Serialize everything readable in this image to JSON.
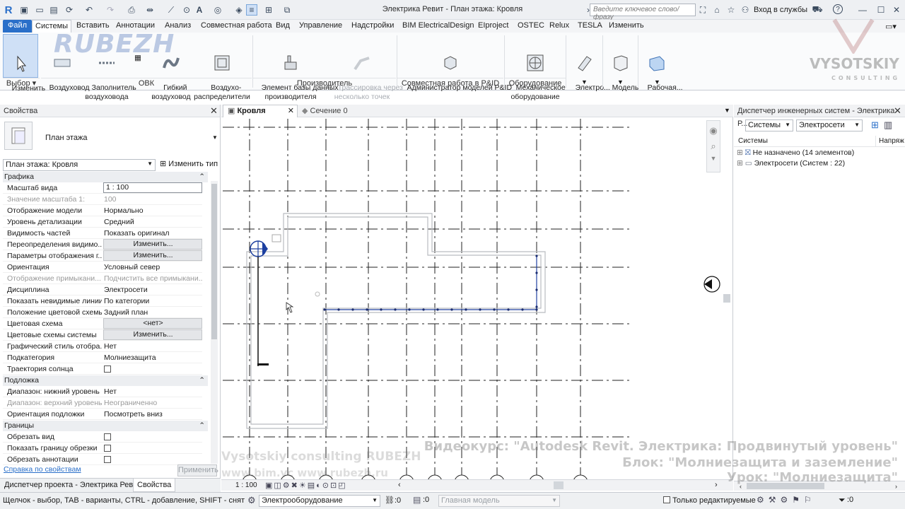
{
  "app": {
    "title": "Электрика Ревит - План этажа: Кровля",
    "search_placeholder": "Введите ключевое слово/фразу",
    "login": "Вход в службы",
    "accent": "#2a6fc9"
  },
  "tabs": [
    {
      "label": "Файл"
    },
    {
      "label": "Системы"
    },
    {
      "label": "Вставить"
    },
    {
      "label": "Аннотации"
    },
    {
      "label": "Анализ"
    },
    {
      "label": "Совместная работа"
    },
    {
      "label": "Вид"
    },
    {
      "label": "Управление"
    },
    {
      "label": "Надстройки"
    },
    {
      "label": "BIM ElectricalDesign"
    },
    {
      "label": "EIproject"
    },
    {
      "label": "OSTEC"
    },
    {
      "label": "Relux"
    },
    {
      "label": "TESLA"
    },
    {
      "label": "Изменить"
    }
  ],
  "ribbon": {
    "buttons": [
      {
        "label": "Изменить"
      },
      {
        "label": "Воздуховод"
      },
      {
        "label": "Заполнитель\nвоздуховода"
      },
      {
        "label": "Гибкий\nвоздуховод"
      },
      {
        "label": "Воздухо-\nраспределители"
      },
      {
        "label": "Элемент базы данных\nпроизводителя"
      },
      {
        "label": "Трассировка через\nнесколько точек"
      },
      {
        "label": "Администратор моделей P&ID"
      },
      {
        "label": "Механическое\nоборудование"
      },
      {
        "label": "Электро..."
      },
      {
        "label": "Модель"
      },
      {
        "label": "Рабочая..."
      }
    ],
    "groups": [
      {
        "label": "Выбор"
      },
      {
        "label": "ОВК"
      },
      {
        "label": "Производитель"
      },
      {
        "label": "Совместная работа в P&ID"
      },
      {
        "label": "Оборудование"
      }
    ]
  },
  "properties": {
    "title": "Свойства",
    "type_name": "План этажа",
    "selector": "План этажа: Кровля",
    "edit_type": "Изменить тип",
    "sections": {
      "graphics": "Графика",
      "underlay": "Подложка",
      "extents": "Границы"
    },
    "rows": [
      {
        "k": "Масштаб вида",
        "v": "1 : 100"
      },
      {
        "k": "Значение масштаба    1:",
        "v": "100"
      },
      {
        "k": "Отображение модели",
        "v": "Нормально"
      },
      {
        "k": "Уровень детализации",
        "v": "Средний"
      },
      {
        "k": "Видимость частей",
        "v": "Показать оригинал"
      },
      {
        "k": "Переопределения видимо...",
        "v": "Изменить..."
      },
      {
        "k": "Параметры отображения г...",
        "v": "Изменить..."
      },
      {
        "k": "Ориентация",
        "v": "Условный север"
      },
      {
        "k": "Отображение примыкани...",
        "v": "Подчистить все примыкани..."
      },
      {
        "k": "Дисциплина",
        "v": "Электросети"
      },
      {
        "k": "Показать невидимые линии",
        "v": "По категории"
      },
      {
        "k": "Положение цветовой схемы",
        "v": "Задний план"
      },
      {
        "k": "Цветовая схема",
        "v": "<нет>"
      },
      {
        "k": "Цветовые схемы системы",
        "v": "Изменить..."
      },
      {
        "k": "Графический стиль отобра...",
        "v": "Нет"
      },
      {
        "k": "Подкатегория",
        "v": "Молниезащита"
      },
      {
        "k": "Траектория солнца",
        "v": ""
      },
      {
        "k": "Диапазон: нижний уровень",
        "v": "Нет"
      },
      {
        "k": "Диапазон: верхний уровень",
        "v": "Неограниченно"
      },
      {
        "k": "Ориентация подложки",
        "v": "Посмотреть вниз"
      },
      {
        "k": "Обрезать вид",
        "v": ""
      },
      {
        "k": "Показать границу обрезки",
        "v": ""
      },
      {
        "k": "Обрезать аннотации",
        "v": ""
      }
    ],
    "help": "Справка по свойствам",
    "apply": "Применить",
    "bottom_tabs": [
      {
        "label": "Диспетчер проекта - Электрика Ревит"
      },
      {
        "label": "Свойства"
      }
    ]
  },
  "view_tabs": [
    {
      "label": "Кровля"
    },
    {
      "label": "Сечение 0"
    }
  ],
  "systems_browser": {
    "title": "Диспетчер инженерных систем - Электрика Р...",
    "dd1": "Системы",
    "dd2": "Электросети",
    "col1": "Системы",
    "col2": "Напряж",
    "items": [
      {
        "label": "Не назначено (14 элементов)"
      },
      {
        "label": "Электросети (Систем : 22)"
      }
    ]
  },
  "view_bar": {
    "scale": "1 : 100"
  },
  "statusbar": {
    "hint": "Щелчок - выбор, TAB - варианты, CTRL - добавление, SHIFT - снятие выбс",
    "category": "Электрооборудование",
    "zero": ":0",
    "workset": "Главная модель",
    "only_edit": "Только редактируемые",
    "filter_count": ":0"
  },
  "watermarks": {
    "logo": "RUBEZH",
    "brand": "VYSOTSKIY",
    "brand_sub": "CONSULTING",
    "left1": "Vysotskiy consulting   RUBEZH",
    "left2": "www.bim.vc              www.rubezh.ru",
    "course1": "Видеокурс: \"Autodesk Revit. Электрика: Продвинутый уровень\"",
    "course2": "Блок: \"Молниезащита и заземление\"",
    "course3": "Урок: \"Молниезащита\""
  }
}
